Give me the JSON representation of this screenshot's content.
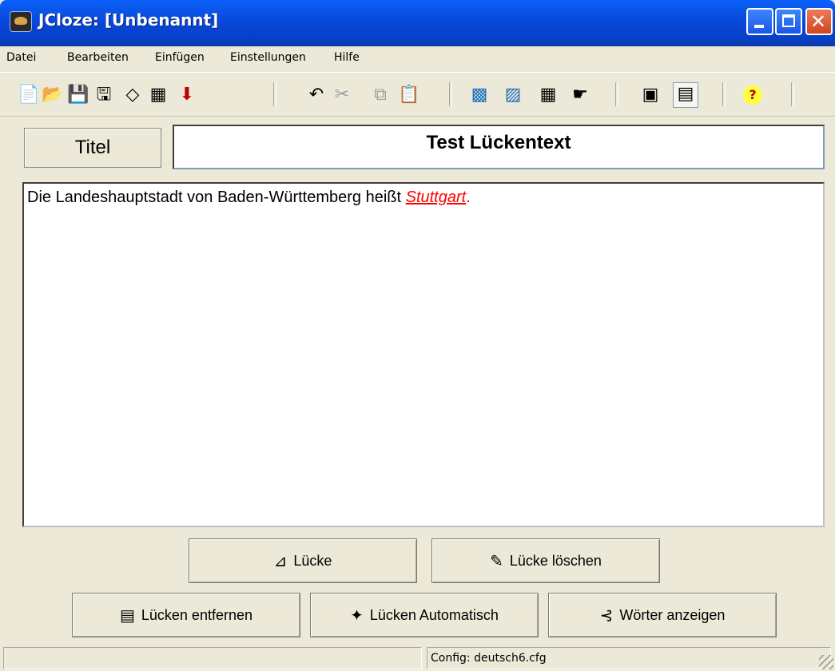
{
  "window": {
    "title": "JCloze: [Unbenannt]"
  },
  "menu": [
    "Datei",
    "Bearbeiten",
    "Einfügen",
    "Einstellungen",
    "Hilfe"
  ],
  "toolbar": {
    "icons": [
      "new-file-icon",
      "open-folder-icon",
      "save-icon",
      "save-as-icon",
      "eraser-icon",
      "export-web-icon",
      "down-arrow-icon",
      "undo-icon",
      "cut-icon",
      "copy-icon",
      "paste-icon",
      "web-page-icon",
      "web-export-icon",
      "drag-drop-icon",
      "hand-icon",
      "config-icon",
      "options-icon",
      "help-icon"
    ]
  },
  "title_row": {
    "label": "Titel",
    "value": "Test Lückentext"
  },
  "text": {
    "before": "Die Landeshauptstadt von Baden-Württemberg heißt ",
    "gap_word": "Stuttgart",
    "after": "."
  },
  "buttons": {
    "gap": "Lücke",
    "delete_gap": "Lücke löschen",
    "remove_gaps": "Lücken entfernen",
    "auto_gaps": "Lücken Automatisch",
    "show_words": "Wörter anzeigen"
  },
  "status": {
    "config": "Config: deutsch6.cfg"
  }
}
